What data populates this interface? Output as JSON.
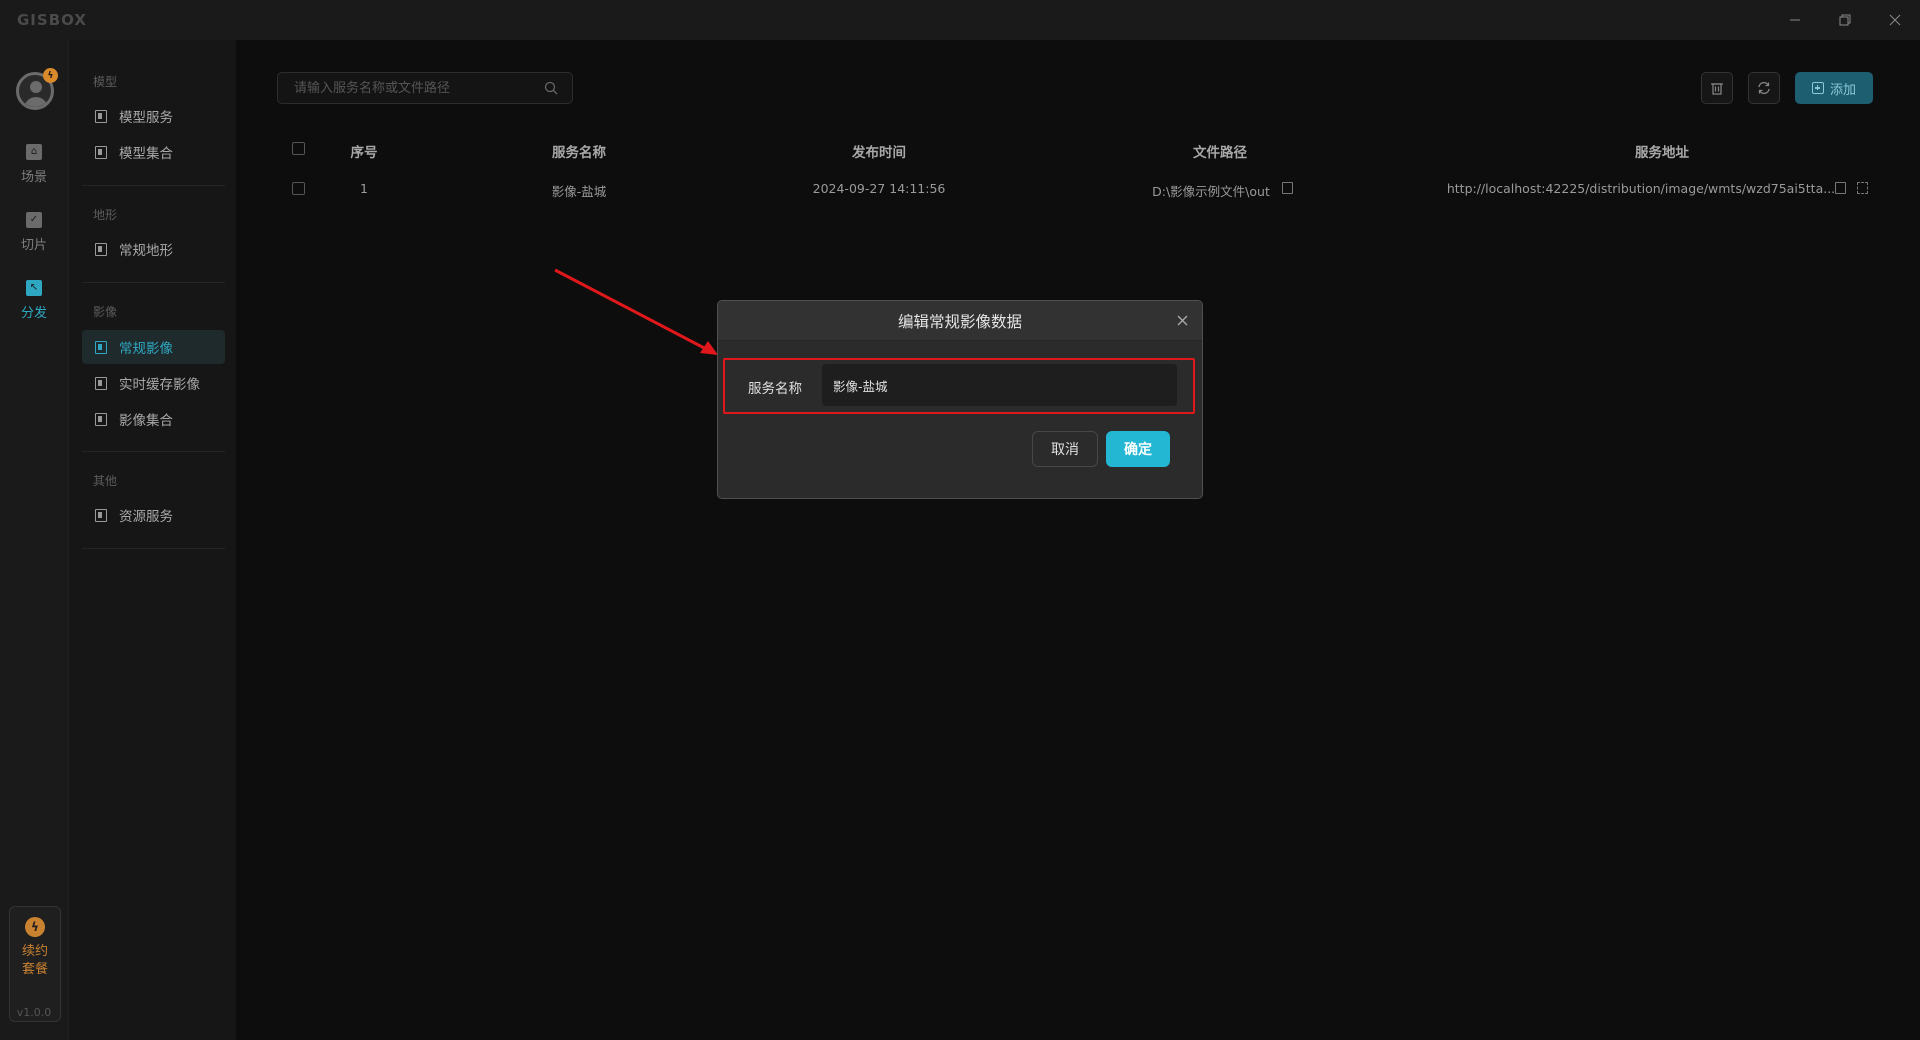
{
  "app": {
    "logo": "GISBOX",
    "version": "v1.0.0"
  },
  "window_controls": {
    "minimize": "−",
    "restore": "❐",
    "close": "✕"
  },
  "rail": {
    "items": [
      {
        "label": "场景",
        "icon": "home-icon",
        "active": false
      },
      {
        "label": "切片",
        "icon": "slice-icon",
        "active": false
      },
      {
        "label": "分发",
        "icon": "distribute-icon",
        "active": true
      }
    ],
    "renew_line1": "续约",
    "renew_line2": "套餐"
  },
  "subnav": {
    "groups": [
      {
        "title": "模型",
        "items": [
          "模型服务",
          "模型集合"
        ]
      },
      {
        "title": "地形",
        "items": [
          "常规地形"
        ]
      },
      {
        "title": "影像",
        "items": [
          "常规影像",
          "实时缓存影像",
          "影像集合"
        ]
      },
      {
        "title": "其他",
        "items": [
          "资源服务"
        ]
      }
    ],
    "active_item": "常规影像"
  },
  "toolbar": {
    "search_placeholder": "请输入服务名称或文件路径",
    "add_label": "添加"
  },
  "table": {
    "columns": [
      "序号",
      "服务名称",
      "发布时间",
      "文件路径",
      "服务地址"
    ],
    "rows": [
      {
        "index": "1",
        "name": "影像-盐城",
        "published": "2024-09-27 14:11:56",
        "path": "D:\\影像示例文件\\out",
        "url": "http://localhost:42225/distribution/image/wmts/wzd75ai5tta..."
      }
    ]
  },
  "modal": {
    "title": "编辑常规影像数据",
    "field_label": "服务名称",
    "field_value": "影像-盐城",
    "cancel_label": "取消",
    "ok_label": "确定"
  },
  "colors": {
    "accent": "#23b7d3",
    "annotation_red": "#e0181b",
    "warning_orange": "#c98230"
  }
}
